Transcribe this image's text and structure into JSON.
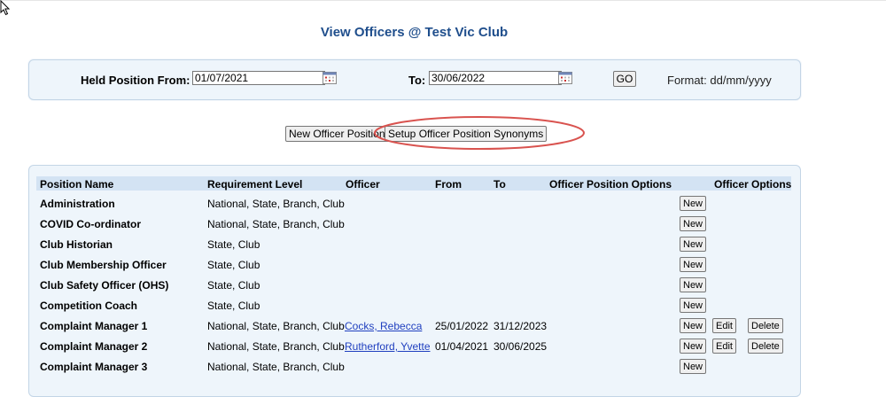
{
  "page": {
    "title": "View Officers @ Test Vic Club"
  },
  "filter": {
    "held_from_label": "Held Position From:",
    "held_from_value": "01/07/2021",
    "to_label": "To:",
    "to_value": "30/06/2022",
    "go_label": "GO",
    "format_text": "Format: dd/mm/yyyy"
  },
  "actions": {
    "new_officer_position": "New Officer Position",
    "setup_synonyms": "Setup Officer Position Synonyms"
  },
  "table": {
    "headers": {
      "position": "Position Name",
      "requirement": "Requirement Level",
      "officer": "Officer",
      "from": "From",
      "to": "To",
      "position_options": "Officer Position Options",
      "officer_options": "Officer Options"
    },
    "button_labels": {
      "new": "New",
      "edit": "Edit",
      "delete": "Delete"
    },
    "rows": [
      {
        "position": "Administration",
        "requirement": "National, State, Branch, Club",
        "officer": "",
        "from": "",
        "to": ""
      },
      {
        "position": "COVID Co-ordinator",
        "requirement": "National, State, Branch, Club",
        "officer": "",
        "from": "",
        "to": ""
      },
      {
        "position": "Club Historian",
        "requirement": "State, Club",
        "officer": "",
        "from": "",
        "to": ""
      },
      {
        "position": "Club Membership Officer",
        "requirement": "State, Club",
        "officer": "",
        "from": "",
        "to": ""
      },
      {
        "position": "Club Safety Officer (OHS)",
        "requirement": "State, Club",
        "officer": "",
        "from": "",
        "to": ""
      },
      {
        "position": "Competition Coach",
        "requirement": "State, Club",
        "officer": "",
        "from": "",
        "to": ""
      },
      {
        "position": "Complaint Manager 1",
        "requirement": "National, State, Branch, Club",
        "officer": "Cocks, Rebecca",
        "from": "25/01/2022",
        "to": "31/12/2023"
      },
      {
        "position": "Complaint Manager 2",
        "requirement": "National, State, Branch, Club",
        "officer": "Rutherford, Yvette",
        "from": "01/04/2021",
        "to": "30/06/2025"
      },
      {
        "position": "Complaint Manager 3",
        "requirement": "National, State, Branch, Club",
        "officer": "",
        "from": "",
        "to": ""
      }
    ]
  },
  "colors": {
    "title": "#1f4e8c",
    "panel_bg": "#eef5fb",
    "header_bg": "#d3e3f3",
    "highlight": "#d9534f",
    "link": "#1f3fbf"
  }
}
